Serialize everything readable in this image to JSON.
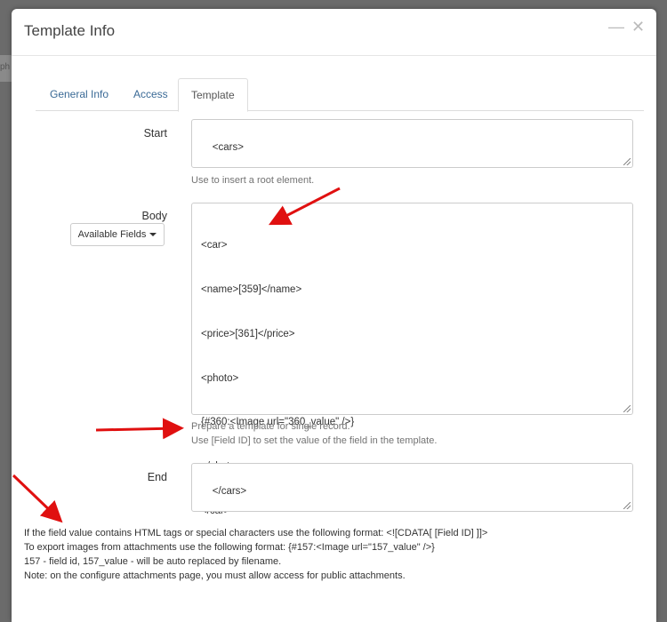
{
  "background": {
    "partial_text": "ph"
  },
  "modal": {
    "title": "Template Info",
    "minimize_icon": "—",
    "close_icon": "✕"
  },
  "tabs": [
    {
      "label": "General Info"
    },
    {
      "label": "Access"
    },
    {
      "label": "Template",
      "active": true
    }
  ],
  "start": {
    "label": "Start",
    "value": "<cars>",
    "help": "Use to insert a root element."
  },
  "body": {
    "label": "Body",
    "dropdown_label": "Available Fields",
    "lines": [
      "<car>",
      "<name>[359]</name>",
      "<price>[361]</price>",
      "<photo>",
      "{#360:<Image url=\"360_value\" />}",
      "</photo>",
      "</car>"
    ],
    "help": [
      "Prepare a template for single record.",
      "Use [Field ID] to set the value of the field in the template."
    ]
  },
  "end": {
    "label": "End",
    "value": "</cars>"
  },
  "notes": [
    "If the field value contains HTML tags or special characters use the following format: <![CDATA[ [Field ID] ]]>",
    "To export images from attachments use the following format: {#157:<Image url=\"157_value\" />}",
    "157 - field id, 157_value - will be auto replaced by filename.",
    "Note: on the configure attachments page, you must allow access for public attachments."
  ],
  "colors": {
    "accent_link": "#3a6a96",
    "arrow": "#e01010"
  }
}
